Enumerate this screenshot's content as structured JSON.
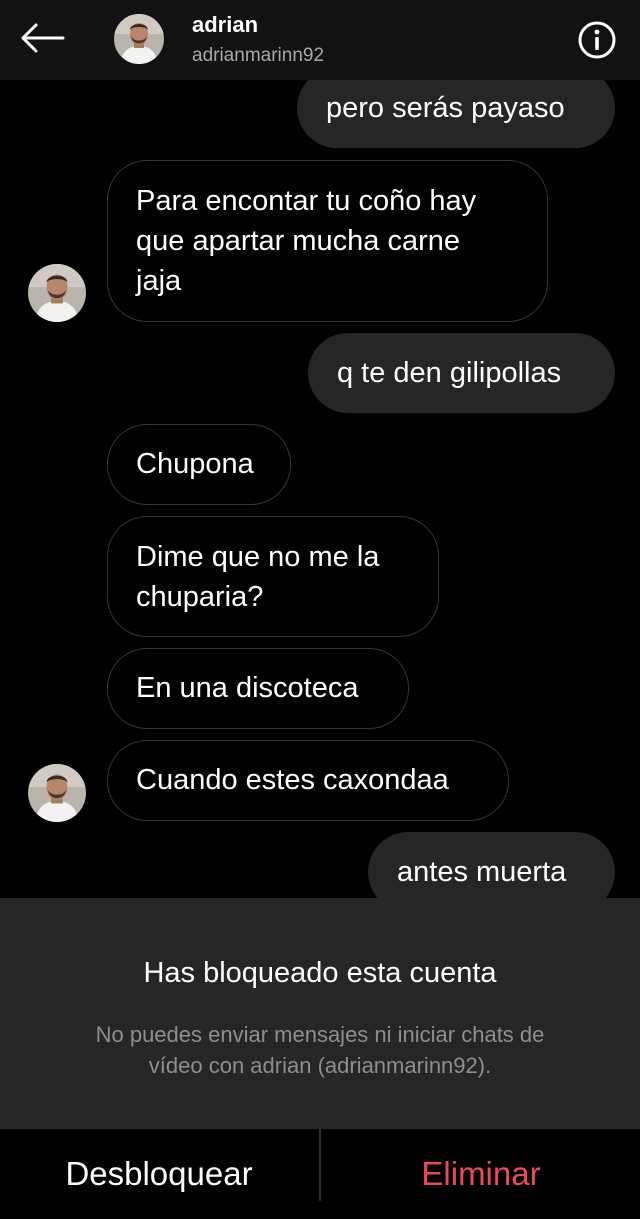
{
  "header": {
    "back_icon": "arrow-left-icon",
    "name": "adrian",
    "username": "adrianmarinn92",
    "info_icon": "info-circle-icon"
  },
  "messages": [
    {
      "side": "sent",
      "text": "pero serás payaso"
    },
    {
      "side": "received",
      "lines": [
        "Para encontar tu coño hay",
        "que apartar mucha carne",
        "jaja"
      ]
    },
    {
      "side": "sent",
      "text": "q te den gilipollas"
    },
    {
      "side": "received",
      "text": "Chupona"
    },
    {
      "side": "received",
      "lines": [
        "Dime que no me la",
        "chuparia?"
      ]
    },
    {
      "side": "received",
      "text": "En una discoteca"
    },
    {
      "side": "received",
      "text": "Cuando estes caxondaa"
    },
    {
      "side": "sent",
      "text": "antes muerta"
    }
  ],
  "blocked": {
    "title": "Has bloqueado esta cuenta",
    "description_line1": "No puedes enviar mensajes ni iniciar chats de",
    "description_line2": "vídeo con adrian (adrianmarinn92)."
  },
  "actions": {
    "unblock_label": "Desbloquear",
    "delete_label": "Eliminar",
    "delete_color": "#ed4956"
  },
  "colors": {
    "background": "#000000",
    "header_bg": "#121212",
    "sent_bubble": "#262626",
    "received_border": "#363636",
    "panel_bg": "#262626",
    "muted_text": "#8e8e8e"
  }
}
